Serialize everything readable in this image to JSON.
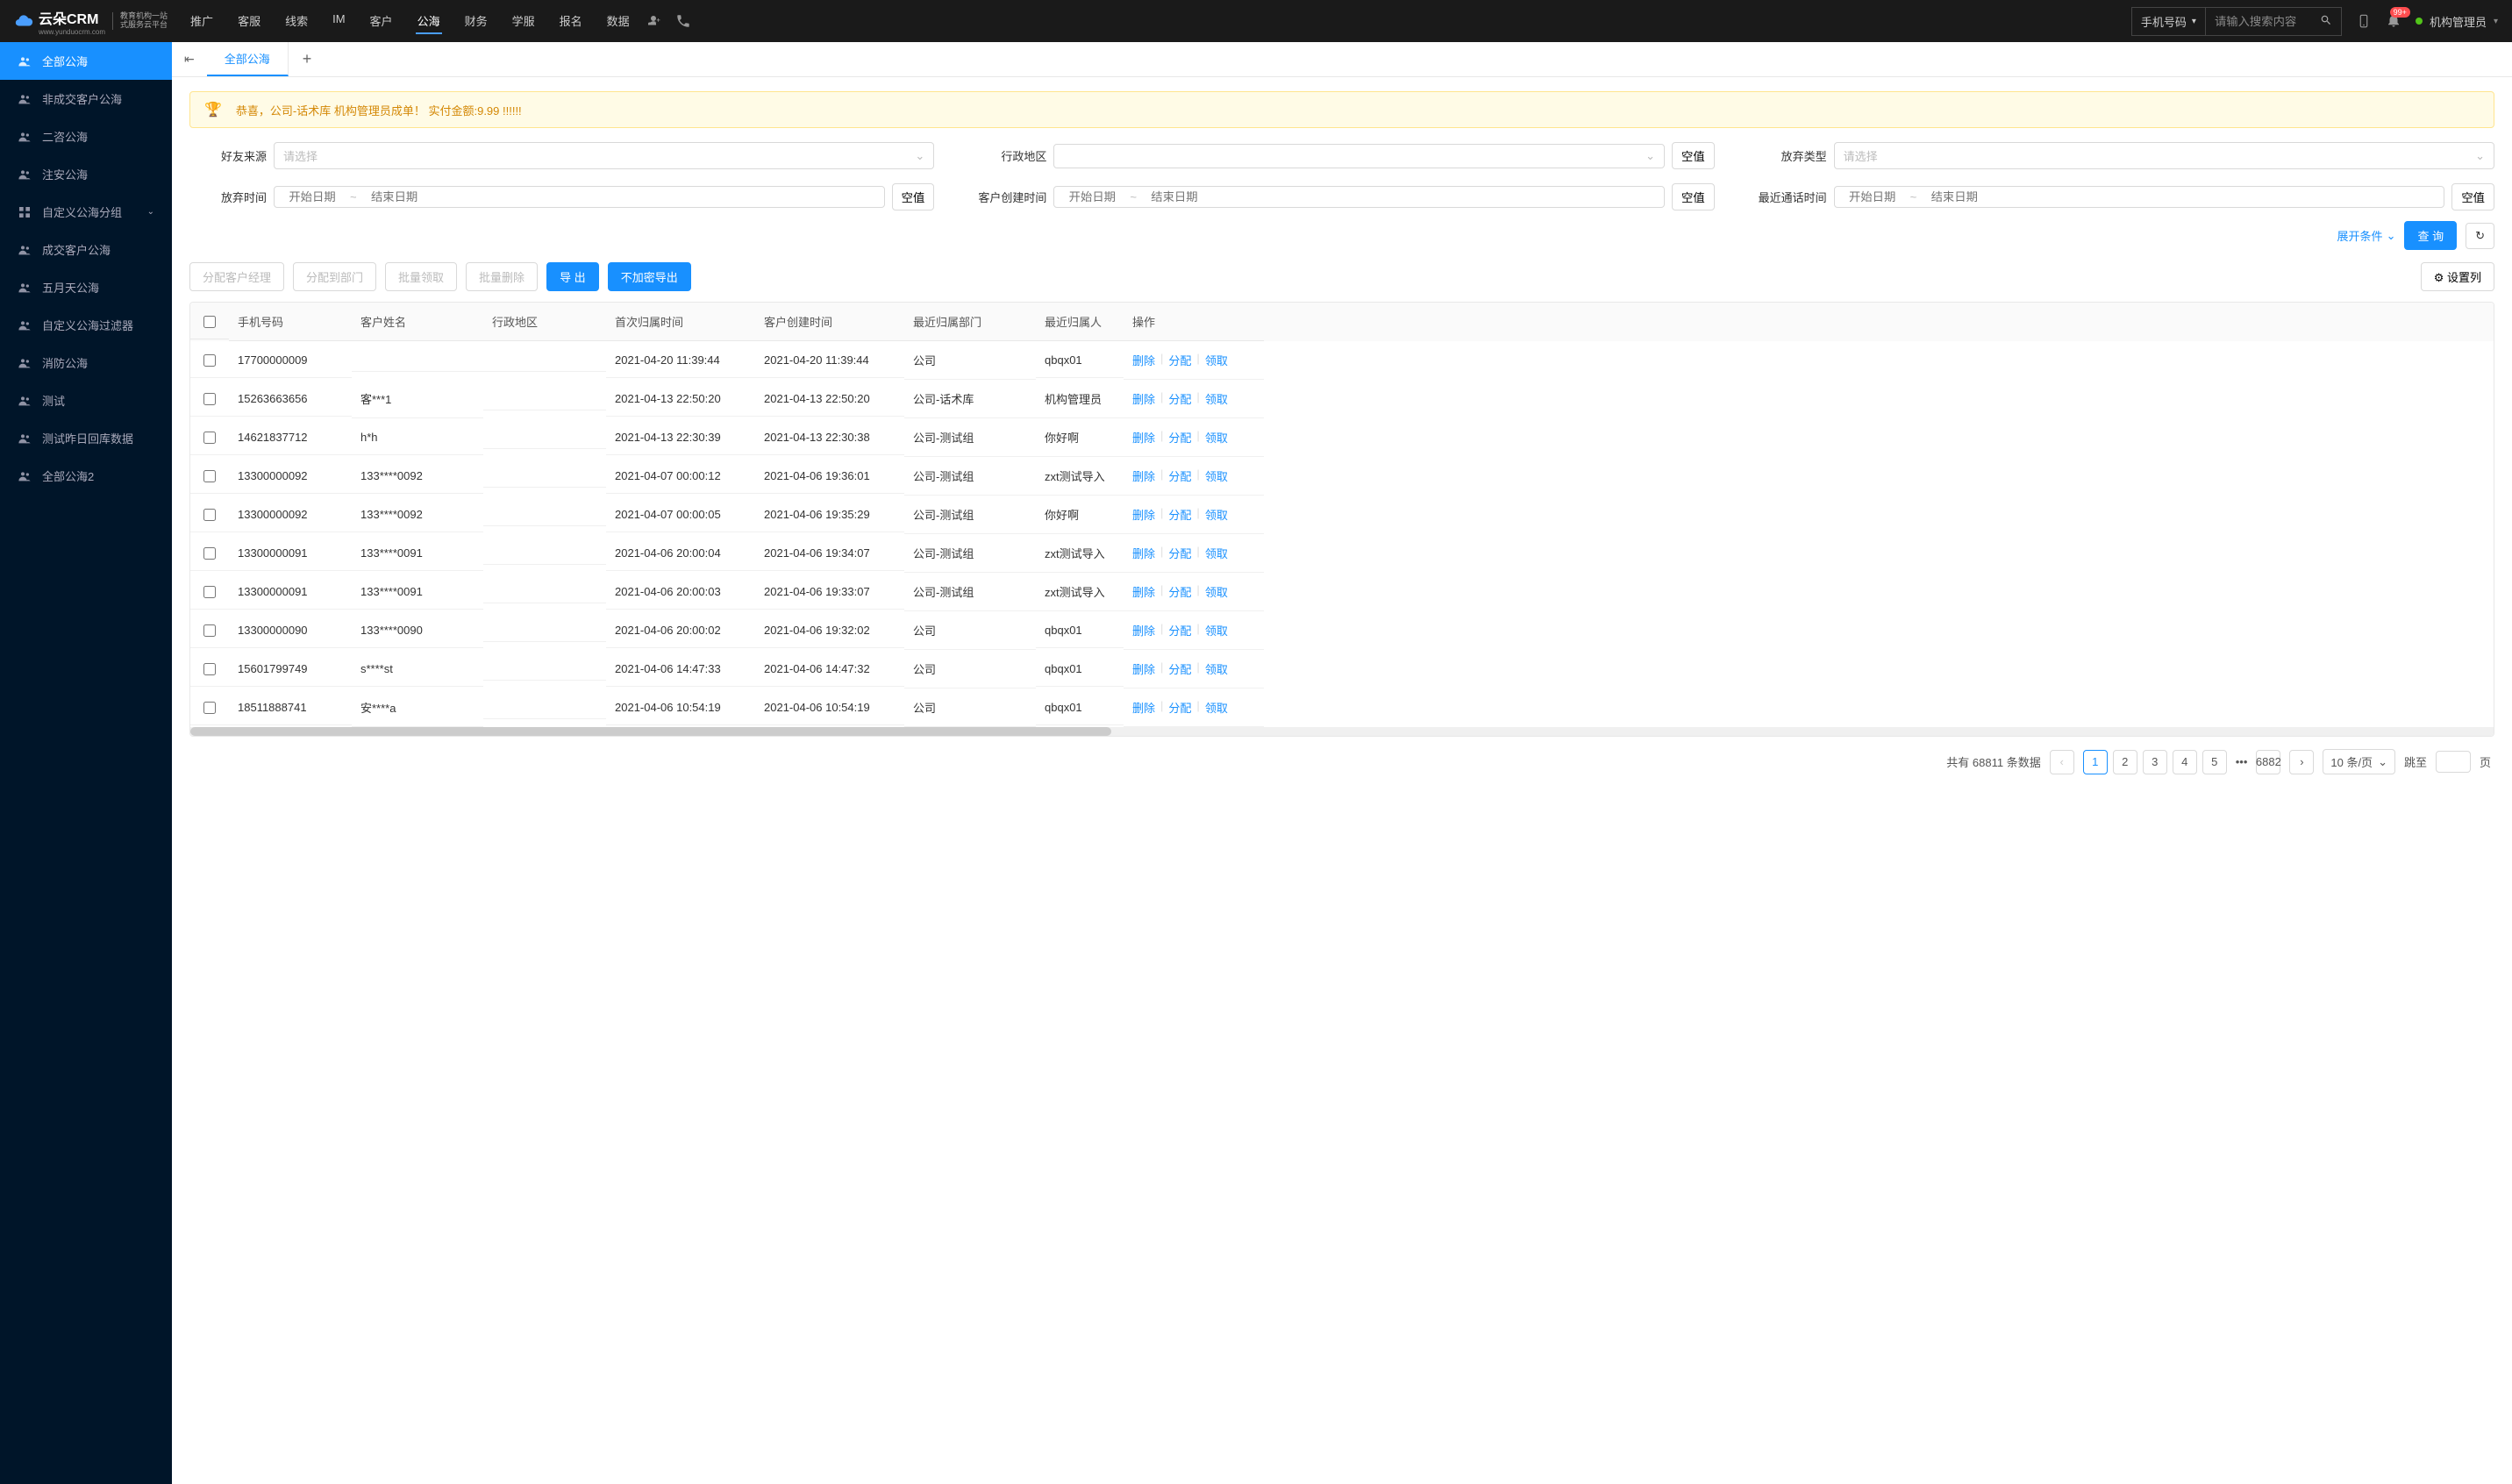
{
  "header": {
    "logo": "云朵CRM",
    "logo_url": "www.yunduocrm.com",
    "logo_sub1": "教育机构一站",
    "logo_sub2": "式服务云平台",
    "nav": [
      "推广",
      "客服",
      "线索",
      "IM",
      "客户",
      "公海",
      "财务",
      "学服",
      "报名",
      "数据"
    ],
    "nav_active": "公海",
    "search_type": "手机号码",
    "search_placeholder": "请输入搜索内容",
    "notif_badge": "99+",
    "user_name": "机构管理员"
  },
  "sidebar": {
    "items": [
      {
        "label": "全部公海",
        "active": true,
        "icon": "users"
      },
      {
        "label": "非成交客户公海",
        "icon": "users"
      },
      {
        "label": "二咨公海",
        "icon": "users"
      },
      {
        "label": "注安公海",
        "icon": "users"
      },
      {
        "label": "自定义公海分组",
        "icon": "grid",
        "expandable": true
      },
      {
        "label": "成交客户公海",
        "icon": "users"
      },
      {
        "label": "五月天公海",
        "icon": "users"
      },
      {
        "label": "自定义公海过滤器",
        "icon": "users"
      },
      {
        "label": "消防公海",
        "icon": "users"
      },
      {
        "label": "测试",
        "icon": "users"
      },
      {
        "label": "测试昨日回库数据",
        "icon": "users"
      },
      {
        "label": "全部公海2",
        "icon": "users"
      }
    ]
  },
  "tabs": {
    "active": "全部公海"
  },
  "announce": "恭喜，公司-话术库  机构管理员成单！  实付金额:9.99 !!!!!!",
  "filters": {
    "friend_source": {
      "label": "好友来源",
      "placeholder": "请选择"
    },
    "admin_region": {
      "label": "行政地区",
      "placeholder": ""
    },
    "abandon_type": {
      "label": "放弃类型",
      "placeholder": "请选择"
    },
    "abandon_time": {
      "label": "放弃时间"
    },
    "create_time": {
      "label": "客户创建时间"
    },
    "last_call_time": {
      "label": "最近通话时间"
    },
    "date_start": "开始日期",
    "date_end": "结束日期",
    "null_btn": "空值",
    "expand": "展开条件",
    "query": "查 询"
  },
  "toolbar": {
    "assign_manager": "分配客户经理",
    "assign_dept": "分配到部门",
    "batch_claim": "批量领取",
    "batch_delete": "批量删除",
    "export": "导 出",
    "export_raw": "不加密导出",
    "set_columns": "设置列"
  },
  "table": {
    "headers": [
      "手机号码",
      "客户姓名",
      "行政地区",
      "首次归属时间",
      "客户创建时间",
      "最近归属部门",
      "最近归属人",
      "操作"
    ],
    "ops": {
      "delete": "删除",
      "assign": "分配",
      "claim": "领取"
    },
    "rows": [
      {
        "phone": "17700000009",
        "name": "",
        "region": "",
        "first_time": "2021-04-20 11:39:44",
        "create_time": "2021-04-20 11:39:44",
        "dept": "公司",
        "owner": "qbqx01"
      },
      {
        "phone": "15263663656",
        "name": "客***1",
        "region": "",
        "first_time": "2021-04-13 22:50:20",
        "create_time": "2021-04-13 22:50:20",
        "dept": "公司-话术库",
        "owner": "机构管理员"
      },
      {
        "phone": "14621837712",
        "name": "h*h",
        "region": "",
        "first_time": "2021-04-13 22:30:39",
        "create_time": "2021-04-13 22:30:38",
        "dept": "公司-测试组",
        "owner": "你好啊"
      },
      {
        "phone": "13300000092",
        "name": "133****0092",
        "region": "",
        "first_time": "2021-04-07 00:00:12",
        "create_time": "2021-04-06 19:36:01",
        "dept": "公司-测试组",
        "owner": "zxt测试导入"
      },
      {
        "phone": "13300000092",
        "name": "133****0092",
        "region": "",
        "first_time": "2021-04-07 00:00:05",
        "create_time": "2021-04-06 19:35:29",
        "dept": "公司-测试组",
        "owner": "你好啊"
      },
      {
        "phone": "13300000091",
        "name": "133****0091",
        "region": "",
        "first_time": "2021-04-06 20:00:04",
        "create_time": "2021-04-06 19:34:07",
        "dept": "公司-测试组",
        "owner": "zxt测试导入"
      },
      {
        "phone": "13300000091",
        "name": "133****0091",
        "region": "",
        "first_time": "2021-04-06 20:00:03",
        "create_time": "2021-04-06 19:33:07",
        "dept": "公司-测试组",
        "owner": "zxt测试导入"
      },
      {
        "phone": "13300000090",
        "name": "133****0090",
        "region": "",
        "first_time": "2021-04-06 20:00:02",
        "create_time": "2021-04-06 19:32:02",
        "dept": "公司",
        "owner": "qbqx01"
      },
      {
        "phone": "15601799749",
        "name": "s****st",
        "region": "",
        "first_time": "2021-04-06 14:47:33",
        "create_time": "2021-04-06 14:47:32",
        "dept": "公司",
        "owner": "qbqx01"
      },
      {
        "phone": "18511888741",
        "name": "安****a",
        "region": "",
        "first_time": "2021-04-06 10:54:19",
        "create_time": "2021-04-06 10:54:19",
        "dept": "公司",
        "owner": "qbqx01"
      }
    ]
  },
  "pager": {
    "total_prefix": "共有",
    "total": "68811",
    "total_suffix": "条数据",
    "pages": [
      "1",
      "2",
      "3",
      "4",
      "5"
    ],
    "last": "6882",
    "size": "10 条/页",
    "jump_prefix": "跳至",
    "jump_suffix": "页"
  }
}
